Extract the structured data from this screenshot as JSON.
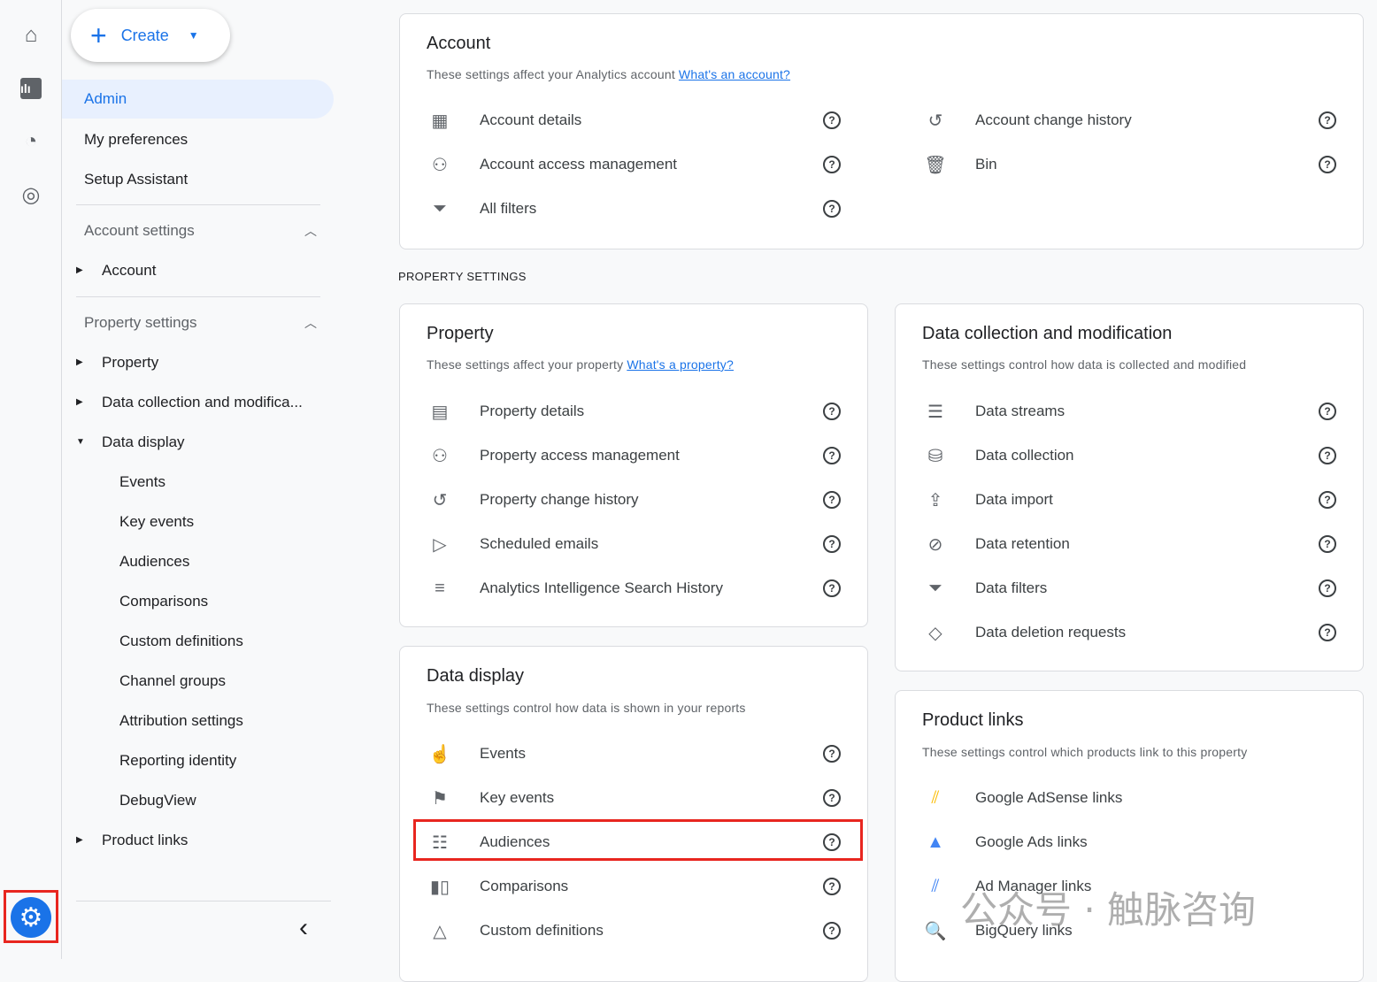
{
  "rail": {
    "icons": [
      "home-icon",
      "reports-icon",
      "explore-icon",
      "advertising-icon"
    ],
    "settings_icon": "gear-icon"
  },
  "create": {
    "label": "Create"
  },
  "sidebar": {
    "top": [
      "Admin",
      "My preferences",
      "Setup Assistant"
    ],
    "account_settings": "Account settings",
    "account": "Account",
    "property_settings": "Property settings",
    "property": "Property",
    "data_collection": "Data collection and modifica...",
    "data_display": "Data display",
    "data_display_children": [
      "Events",
      "Key events",
      "Audiences",
      "Comparisons",
      "Custom definitions",
      "Channel groups",
      "Attribution settings",
      "Reporting identity",
      "DebugView"
    ],
    "product_links": "Product links"
  },
  "account_card": {
    "title": "Account",
    "desc": "These settings affect your Analytics account",
    "link": "What's an account?",
    "left": [
      {
        "icon": "building-icon",
        "label": "Account details"
      },
      {
        "icon": "people-icon",
        "label": "Account access management"
      },
      {
        "icon": "filter-icon",
        "label": "All filters"
      }
    ],
    "right": [
      {
        "icon": "history-icon",
        "label": "Account change history"
      },
      {
        "icon": "trash-icon",
        "label": "Bin"
      }
    ]
  },
  "section_label": "PROPERTY SETTINGS",
  "property_card": {
    "title": "Property",
    "desc": "These settings affect your property",
    "link": "What's a property?",
    "items": [
      {
        "icon": "property-details-icon",
        "label": "Property details"
      },
      {
        "icon": "people-icon",
        "label": "Property access management"
      },
      {
        "icon": "history-icon",
        "label": "Property change history"
      },
      {
        "icon": "scheduled-email-icon",
        "label": "Scheduled emails"
      },
      {
        "icon": "search-history-icon",
        "label": "Analytics Intelligence Search History"
      }
    ]
  },
  "data_collection_card": {
    "title": "Data collection and modification",
    "desc": "These settings control how data is collected and modified",
    "items": [
      {
        "icon": "streams-icon",
        "label": "Data streams"
      },
      {
        "icon": "database-icon",
        "label": "Data collection"
      },
      {
        "icon": "upload-icon",
        "label": "Data import"
      },
      {
        "icon": "retention-icon",
        "label": "Data retention"
      },
      {
        "icon": "filter-icon",
        "label": "Data filters"
      },
      {
        "icon": "eraser-icon",
        "label": "Data deletion requests"
      }
    ]
  },
  "data_display_card": {
    "title": "Data display",
    "desc": "These settings control how data is shown in your reports",
    "items": [
      {
        "icon": "touch-icon",
        "label": "Events"
      },
      {
        "icon": "flag-icon",
        "label": "Key events"
      },
      {
        "icon": "audience-icon",
        "label": "Audiences"
      },
      {
        "icon": "comparison-icon",
        "label": "Comparisons"
      },
      {
        "icon": "shapes-icon",
        "label": "Custom definitions"
      }
    ]
  },
  "product_links_card": {
    "title": "Product links",
    "desc": "These settings control which products link to this property",
    "items": [
      {
        "icon": "adsense-icon",
        "label": "Google AdSense links"
      },
      {
        "icon": "google-ads-icon",
        "label": "Google Ads links"
      },
      {
        "icon": "ad-manager-icon",
        "label": "Ad Manager links"
      },
      {
        "icon": "bigquery-icon",
        "label": "BigQuery links"
      }
    ]
  },
  "watermark": "公众号 · 触脉咨询",
  "colors": {
    "accent": "#1a73e8",
    "highlight": "#e8261f"
  }
}
